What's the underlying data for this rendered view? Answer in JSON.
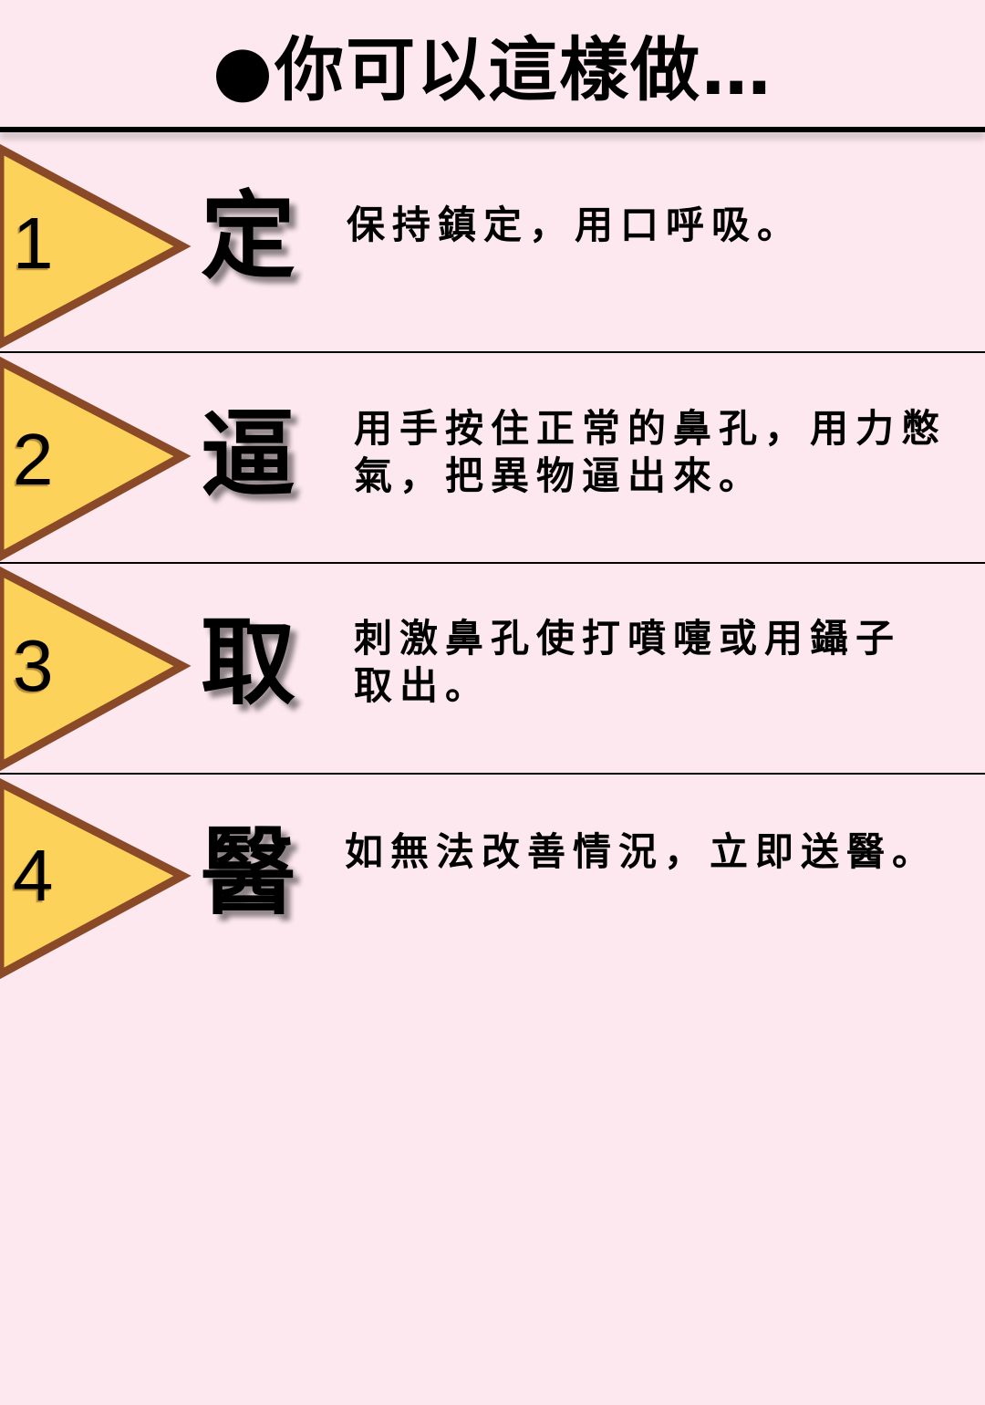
{
  "title": "●你可以這樣做…",
  "colors": {
    "background": "#fce8ee",
    "chevron_fill": "#fcd25a",
    "chevron_border": "#8a4a28"
  },
  "steps": [
    {
      "number": "1",
      "keyword": "定",
      "description": "保持鎮定，用口呼吸。"
    },
    {
      "number": "2",
      "keyword": "逼",
      "description": "用手按住正常的鼻孔，用力憋氣，把異物逼出來。"
    },
    {
      "number": "3",
      "keyword": "取",
      "description": "刺激鼻孔使打噴嚏或用鑷子取出。"
    },
    {
      "number": "4",
      "keyword": "醫",
      "description": "如無法改善情況，立即送醫。"
    }
  ]
}
